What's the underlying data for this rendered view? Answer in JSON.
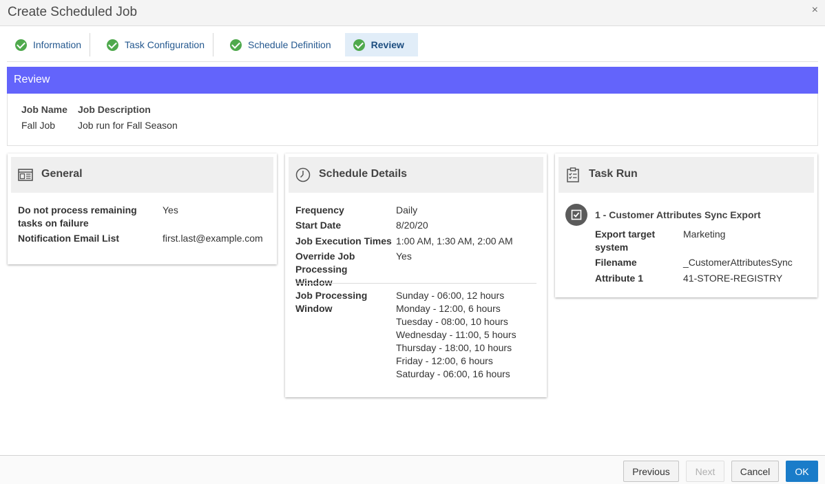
{
  "dialog": {
    "title": "Create Scheduled Job",
    "close_symbol": "×"
  },
  "train": [
    {
      "label": "Information",
      "state": "done"
    },
    {
      "label": "Task Configuration",
      "state": "done"
    },
    {
      "label": "Schedule Definition",
      "state": "done"
    },
    {
      "label": "Review",
      "state": "active"
    }
  ],
  "review": {
    "header": "Review",
    "job_name_label": "Job Name",
    "job_description_label": "Job Description",
    "job_name": "Fall Job",
    "job_description": "Job run for Fall Season"
  },
  "general": {
    "title": "General",
    "icon": "window-panel-icon",
    "rows": [
      {
        "label": "Do not process remaining tasks on failure",
        "value": "Yes"
      },
      {
        "label": "Notification Email List",
        "value": "first.last@example.com"
      }
    ]
  },
  "schedule": {
    "title": "Schedule Details",
    "icon": "clock-icon",
    "rows": [
      {
        "label": "Frequency",
        "value": "Daily"
      },
      {
        "label": "Start Date",
        "value": "8/20/20"
      },
      {
        "label": "Job Execution Times",
        "value": "1:00 AM, 1:30 AM, 2:00 AM"
      },
      {
        "label": "Override Job Processing Window",
        "value": "Yes"
      }
    ],
    "window_label": "Job Processing Window",
    "window": [
      "Sunday - 06:00, 12 hours",
      "Monday - 12:00, 6 hours",
      "Tuesday - 08:00, 10 hours",
      "Wednesday - 11:00, 5 hours",
      "Thursday - 18:00, 10 hours",
      "Friday - 12:00, 6 hours",
      "Saturday - 06:00, 16 hours"
    ]
  },
  "task_run": {
    "title": "Task Run",
    "icon": "clipboard-checklist-icon",
    "task_title": "1 - Customer Attributes Sync Export",
    "rows": [
      {
        "label": "Export target system",
        "value": "Marketing"
      },
      {
        "label": "Filename",
        "value": "_CustomerAttributesSync"
      },
      {
        "label": "Attribute 1",
        "value": "41-STORE-REGISTRY"
      }
    ]
  },
  "footer": {
    "previous": "Previous",
    "next": "Next",
    "cancel": "Cancel",
    "ok": "OK"
  },
  "colors": {
    "accent": "#6364fb",
    "check": "#4fa94d",
    "primary_button": "#1a7cc9",
    "active_step_bg": "#e1edf8"
  }
}
